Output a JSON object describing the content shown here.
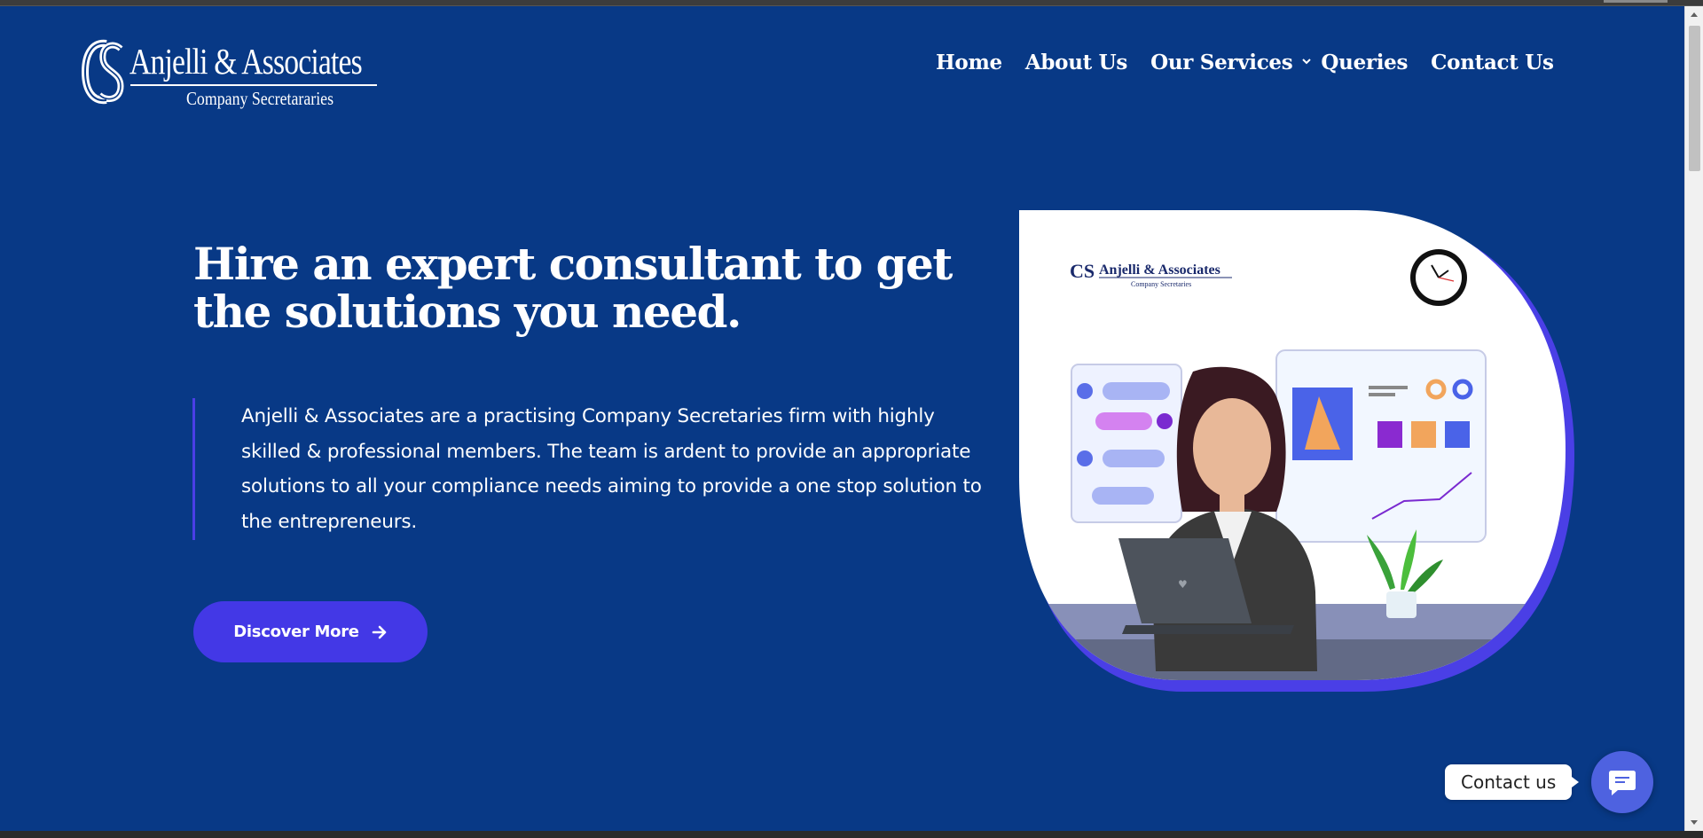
{
  "brand": {
    "name": "Anjelli & Associates",
    "tagline": "Company Secretararies",
    "monogram": "CS"
  },
  "nav": {
    "items": [
      {
        "label": "Home"
      },
      {
        "label": "About Us"
      },
      {
        "label": "Our Services"
      },
      {
        "label": "Queries"
      },
      {
        "label": "Contact Us"
      }
    ]
  },
  "hero": {
    "title": "Hire an expert consultant to get the solutions you need.",
    "description": "Anjelli & Associates are a practising Company Secretaries firm with highly skilled & professional members. The team is ardent to provide an appropriate solutions to all your compliance needs aiming to provide a one stop solution to the entrepreneurs.",
    "cta_label": "Discover More"
  },
  "illustration": {
    "brand_name": "Anjelli & Associates",
    "brand_tagline": "Company Secretaries",
    "monogram": "CS"
  },
  "chat_widget": {
    "label": "Contact us"
  },
  "colors": {
    "background": "#083986",
    "accent": "#4338e6",
    "text": "#ffffff",
    "chat_button": "#4e62e0"
  },
  "icons": {
    "nav_dropdown": "chevron-down-icon",
    "cta": "arrow-right-icon",
    "chat": "chat-bubble-icon"
  }
}
